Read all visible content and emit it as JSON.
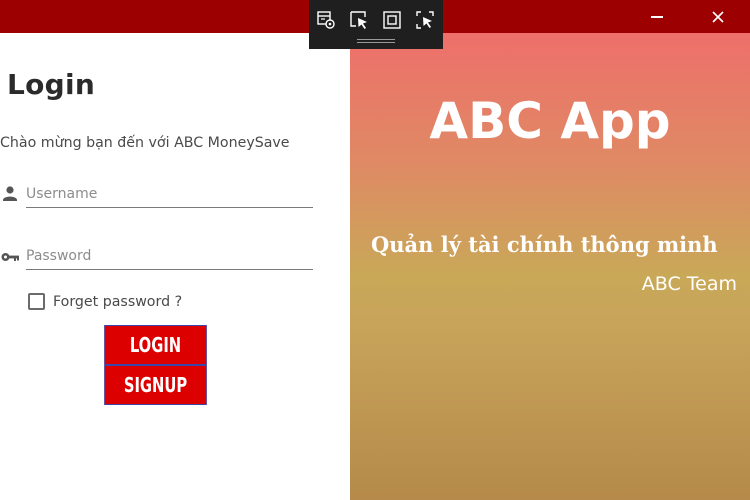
{
  "colors": {
    "titlebar": "#9c0000",
    "button_bg": "#dd0000",
    "button_border": "#3b47a8",
    "gradient_top": "#ee6f6b",
    "gradient_bottom": "#b58a4a"
  },
  "window_controls": {
    "minimize_icon": "minimize-icon",
    "close_icon": "close-icon"
  },
  "debug_toolbar": {
    "icons": [
      "live-visual-tree-icon",
      "select-element-icon",
      "display-layout-adorners-icon",
      "track-focused-element-icon"
    ]
  },
  "login": {
    "title": "Login",
    "welcome": "Chào mừng bạn đến với ABC MoneySave",
    "username_placeholder": "Username",
    "password_placeholder": "Password",
    "username_icon": "user-icon",
    "password_icon": "key-icon",
    "remember_label": "Forget password ?",
    "remember_checked": false,
    "login_button": "LOGIN",
    "signup_button": "SIGNUP"
  },
  "brand": {
    "app_name": "ABC App",
    "tagline": "Quản lý tài chính thông minh",
    "team": "ABC Team"
  }
}
